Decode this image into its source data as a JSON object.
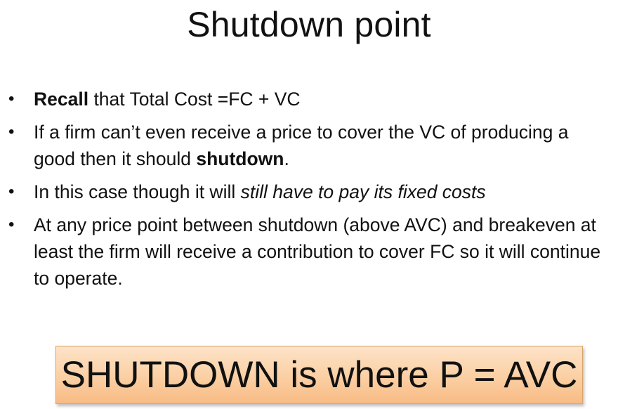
{
  "slide": {
    "title": "Shutdown point",
    "bullets": [
      {
        "bold_lead": "Recall",
        "text": " that Total Cost =FC + VC"
      },
      {
        "text": "If a firm can’t even receive a price to cover the VC of producing a good then it should ",
        "bold_tail": "shutdown",
        "text_end": "."
      },
      {
        "text": "In this case though it will ",
        "italic_tail": "still have to pay its fixed costs"
      },
      {
        "text": "At any price point between shutdown (above AVC) and breakeven at least the firm will receive a contribution to cover FC so it will continue to operate."
      }
    ],
    "callout": "SHUTDOWN is where P = AVC"
  },
  "colors": {
    "background": "#ffffff",
    "text": "#111111",
    "callout_fill": "#fbcfa3",
    "callout_border": "#d9a46a"
  }
}
